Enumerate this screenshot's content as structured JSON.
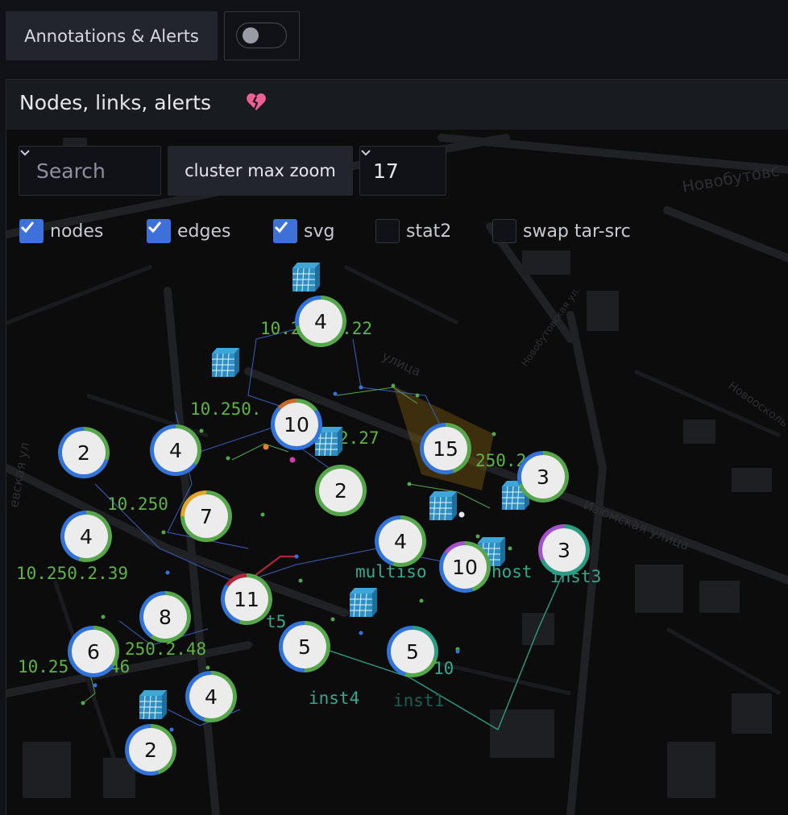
{
  "toolbar": {
    "annotations_label": "Annotations & Alerts",
    "annotations_enabled": false
  },
  "panel": {
    "title": "Nodes, links, alerts",
    "status_icon": "broken-heart-icon"
  },
  "controls": {
    "search_placeholder": "Search",
    "cluster_label": "cluster max zoom",
    "cluster_value": "17"
  },
  "toggles": [
    {
      "label": "nodes",
      "checked": true
    },
    {
      "label": "edges",
      "checked": true
    },
    {
      "label": "svg",
      "checked": true
    },
    {
      "label": "stat2",
      "checked": false
    },
    {
      "label": "swap tar-src",
      "checked": false
    }
  ],
  "map": {
    "street_labels": [
      "Новобутовс",
      "Новобутовская ул.",
      "улица",
      "Изюмская улица",
      "Новоосколь",
      "евская ул"
    ],
    "node_labels": [
      "10.250.2.22",
      "10.250.",
      "2.27",
      "250.2",
      "10.250",
      "10.250.2.39",
      "multiso",
      "host",
      "inst3",
      "t5",
      "250.2.48",
      "10.25",
      "46",
      "inst4",
      "inst1",
      "10"
    ],
    "clusters": [
      "4",
      "10",
      "2",
      "4",
      "15",
      "3",
      "2",
      "7",
      "4",
      "4",
      "10",
      "3",
      "11",
      "8",
      "6",
      "5",
      "5",
      "4",
      "2"
    ]
  },
  "colors": {
    "accent": "#3d71d9",
    "ring_green": "#56a64b",
    "ring_blue": "#3274d9",
    "ring_teal": "#2a9d84",
    "ring_purple": "#a352cc",
    "ring_orange": "#e0a526",
    "label_green": "#5fb346",
    "label_teal": "#3aa88c"
  }
}
